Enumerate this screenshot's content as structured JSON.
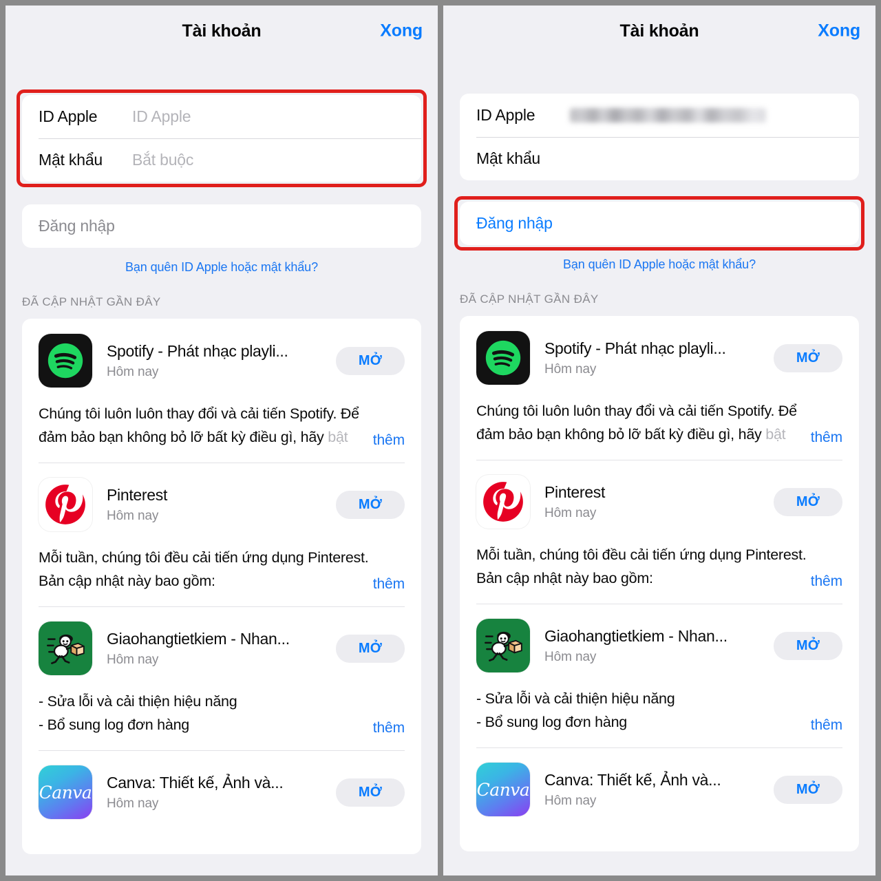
{
  "meta": {
    "accent_blue": "#0a7cff",
    "link_blue": "#1a76f2",
    "annotation_red": "#e01f1c",
    "page_bg": "#f0f0f4",
    "frame_gray": "#8a8a8a"
  },
  "panels": [
    {
      "id": "left",
      "header": {
        "title": "Tài khoản",
        "done_label": "Xong"
      },
      "form": {
        "apple_id": {
          "label": "ID Apple",
          "placeholder": "ID Apple",
          "value": ""
        },
        "password": {
          "label": "Mật khẩu",
          "placeholder": "Bắt buộc",
          "value": ""
        },
        "highlighted": true
      },
      "signin": {
        "label": "Đăng nhập",
        "state": "disabled",
        "highlighted": false
      },
      "forgot_link": "Bạn quên ID Apple hoặc mật khẩu?",
      "section_header": "ĐÃ CẬP NHẬT GẦN ĐÂY"
    },
    {
      "id": "right",
      "header": {
        "title": "Tài khoản",
        "done_label": "Xong"
      },
      "form": {
        "apple_id": {
          "label": "ID Apple",
          "placeholder": "",
          "value": "██████████████",
          "blurred": true
        },
        "password": {
          "label": "Mật khẩu",
          "placeholder": "",
          "value": ""
        },
        "highlighted": false
      },
      "signin": {
        "label": "Đăng nhập",
        "state": "enabled",
        "highlighted": true
      },
      "forgot_link": "Bạn quên ID Apple hoặc mật khẩu?",
      "section_header": "ĐÃ CẬP NHẬT GẦN ĐÂY"
    }
  ],
  "apps": [
    {
      "icon": "spotify-icon",
      "name": "Spotify - Phát nhạc playli...",
      "date": "Hôm nay",
      "open_label": "MỞ",
      "more_label": "thêm",
      "notes": [
        {
          "text": "Chúng tôi luôn luôn thay đổi và cải tiến Spotify. Để",
          "tail": ""
        },
        {
          "text": "đảm bảo bạn không bỏ lỡ bất kỳ điều gì, hãy ",
          "tail": "bật"
        }
      ]
    },
    {
      "icon": "pinterest-icon",
      "name": "Pinterest",
      "date": "Hôm nay",
      "open_label": "MỞ",
      "more_label": "thêm",
      "notes": [
        {
          "text": "Mỗi tuần, chúng tôi đều cải tiến ứng dụng Pinterest.",
          "tail": ""
        },
        {
          "text": "Bản cập nhật này bao gồm:",
          "tail": ""
        }
      ]
    },
    {
      "icon": "ghtk-icon",
      "name": "Giaohangtietkiem - Nhan...",
      "date": "Hôm nay",
      "open_label": "MỞ",
      "more_label": "thêm",
      "notes": [
        {
          "text": "- Sửa lỗi và cải thiện hiệu năng",
          "tail": ""
        },
        {
          "text": "- Bổ sung log đơn hàng",
          "tail": ""
        }
      ]
    },
    {
      "icon": "canva-icon",
      "name": "Canva: Thiết kế, Ảnh và...",
      "date": "Hôm nay",
      "open_label": "MỞ",
      "more_label": "",
      "notes": [],
      "canva_wordmark": "Canva"
    }
  ]
}
